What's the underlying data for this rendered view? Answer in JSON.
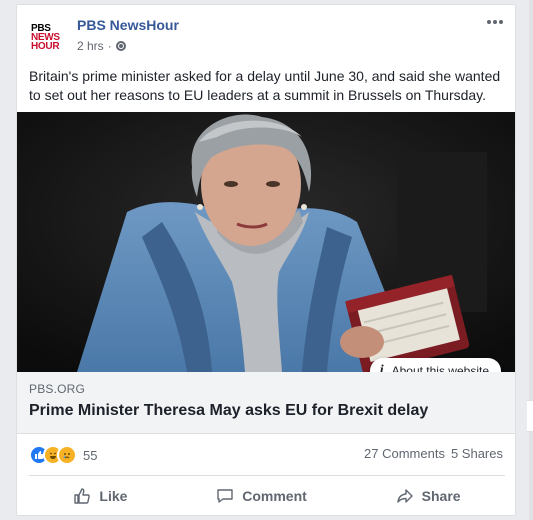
{
  "post": {
    "logo_text": [
      "PBS",
      "NEWS",
      "HOUR"
    ],
    "page_name": "PBS NewsHour",
    "timestamp": "2 hrs",
    "separator": "·",
    "text": "Britain's prime minister asked for a delay until June 30, and said she wanted to set out her reasons to EU leaders at a summit in Brussels on Thursday."
  },
  "link_preview": {
    "about_label": "About this website",
    "domain": "PBS.ORG",
    "title": "Prime Minister Theresa May asks EU for Brexit delay"
  },
  "engagement": {
    "reaction_icons": [
      "like-icon",
      "haha-icon",
      "sad-icon"
    ],
    "reaction_count": "55",
    "comments": "27 Comments",
    "shares": "5 Shares"
  },
  "actions": {
    "like": "Like",
    "comment": "Comment",
    "share": "Share"
  },
  "colors": {
    "link_blue": "#365899",
    "pbs_red": "#c8102e",
    "like_blue": "#2078f4",
    "reaction_yellow": "#f7b125"
  }
}
